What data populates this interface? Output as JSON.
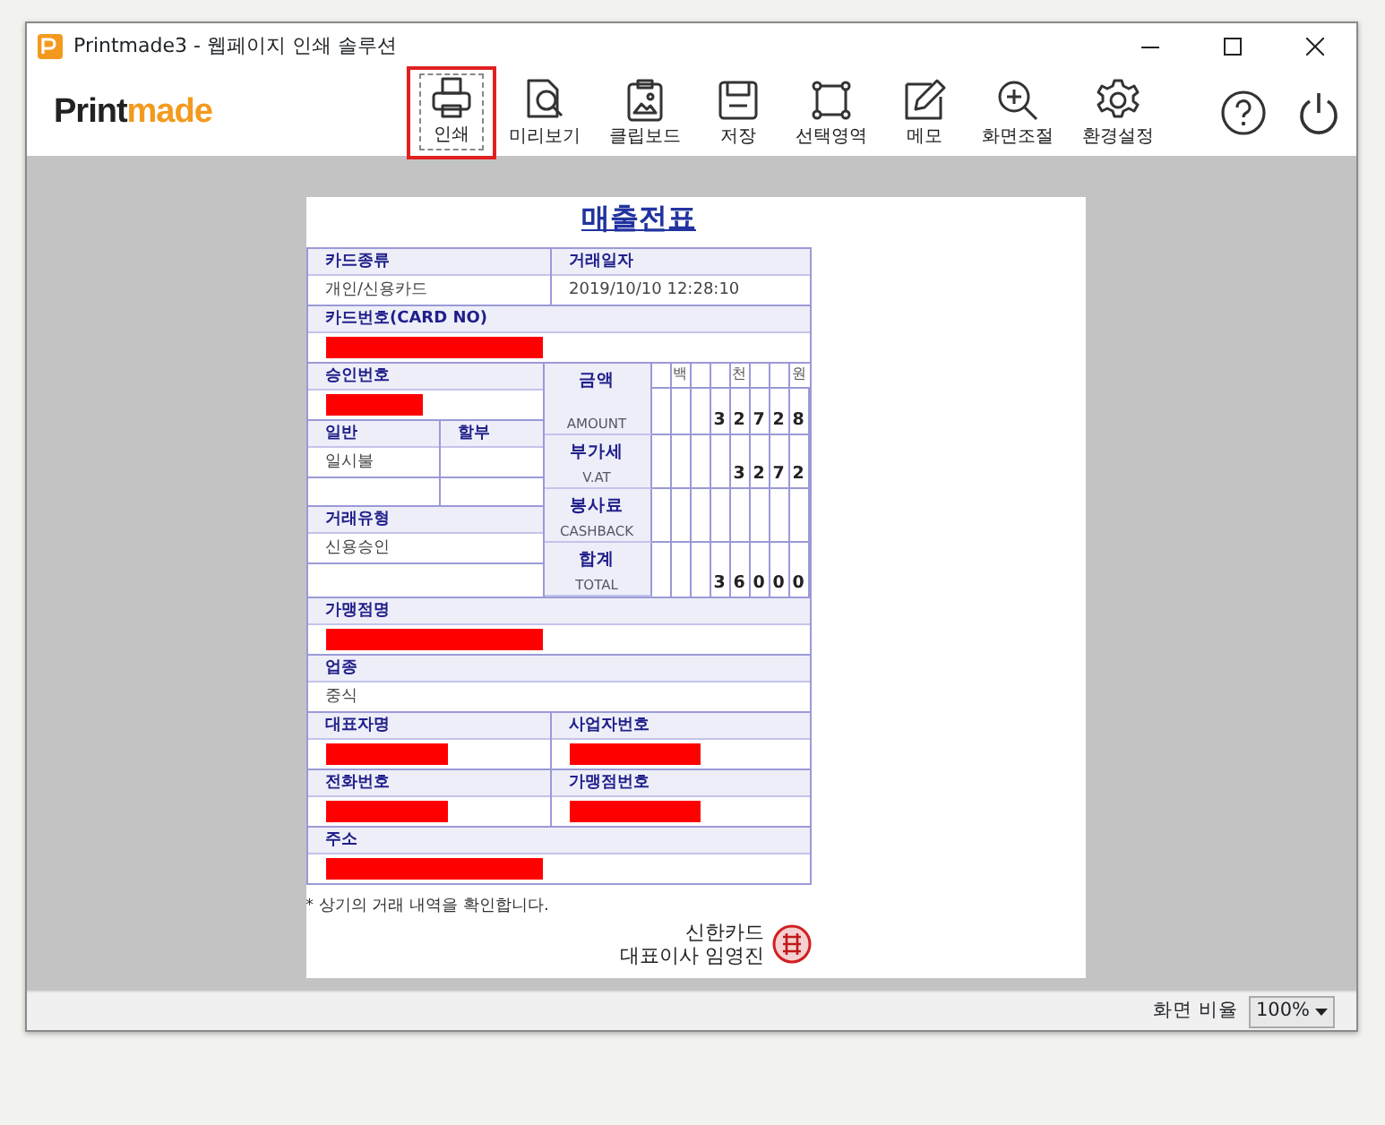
{
  "window": {
    "title": "Printmade3 - 웹페이지 인쇄 솔루션"
  },
  "logo": {
    "dark": "Print",
    "accent": "made"
  },
  "toolbar": [
    {
      "label": "인쇄",
      "selected": true
    },
    {
      "label": "미리보기",
      "selected": false
    },
    {
      "label": "클립보드",
      "selected": false
    },
    {
      "label": "저장",
      "selected": false
    },
    {
      "label": "선택영역",
      "selected": false
    },
    {
      "label": "메모",
      "selected": false
    },
    {
      "label": "화면조절",
      "selected": false
    },
    {
      "label": "환경설정",
      "selected": false
    }
  ],
  "receipt": {
    "title": "매출전표",
    "top_rows": [
      {
        "cells": [
          {
            "label": "카드종류",
            "value": "개인/신용카드"
          },
          {
            "label": "거래일자",
            "value": "2019/10/10 12:28:10"
          }
        ]
      },
      {
        "cells": [
          {
            "label": "카드번호(CARD NO)",
            "redacted": true
          }
        ]
      }
    ],
    "left_rows": [
      {
        "cells": [
          {
            "label": "승인번호",
            "redacted": true
          }
        ]
      },
      {
        "cells": [
          {
            "label": "일반",
            "value": "일시불"
          },
          {
            "label": "할부"
          }
        ],
        "blank_row": true
      },
      {
        "cells": [
          {
            "label": "거래유형",
            "value": "신용승인"
          }
        ],
        "blank_row": true
      }
    ],
    "amounts": {
      "places": [
        "백",
        "천",
        "원"
      ],
      "lines": [
        {
          "label": "금액",
          "sublabel": "AMOUNT",
          "digits": [
            "3",
            "2",
            "7",
            "2",
            "8"
          ]
        },
        {
          "label": "부가세",
          "sublabel": "V.AT",
          "digits": [
            "3",
            "2",
            "7",
            "2"
          ]
        },
        {
          "label": "봉사료",
          "sublabel": "CASHBACK"
        },
        {
          "label": "합계",
          "sublabel": "TOTAL",
          "digits": [
            "3",
            "6",
            "0",
            "0",
            "0"
          ]
        }
      ]
    },
    "bottom_rows": [
      {
        "cells": [
          {
            "label": "가맹점명",
            "redacted": true
          }
        ]
      },
      {
        "cells": [
          {
            "label": "업종",
            "value": "중식"
          }
        ]
      },
      {
        "cells": [
          {
            "label": "대표자명",
            "redacted": true
          },
          {
            "label": "사업자번호",
            "redacted": true
          }
        ]
      },
      {
        "cells": [
          {
            "label": "전화번호",
            "redacted": true
          },
          {
            "label": "가맹점번호",
            "redacted": true
          }
        ]
      },
      {
        "cells": [
          {
            "label": "주소",
            "redacted": true
          }
        ]
      }
    ],
    "note": "* 상기의 거래 내역을 확인합니다.",
    "issuer": "신한카드",
    "signer": "대표이사 임영진"
  },
  "status_bar": {
    "label": "화면 비율",
    "zoom": "100%"
  }
}
